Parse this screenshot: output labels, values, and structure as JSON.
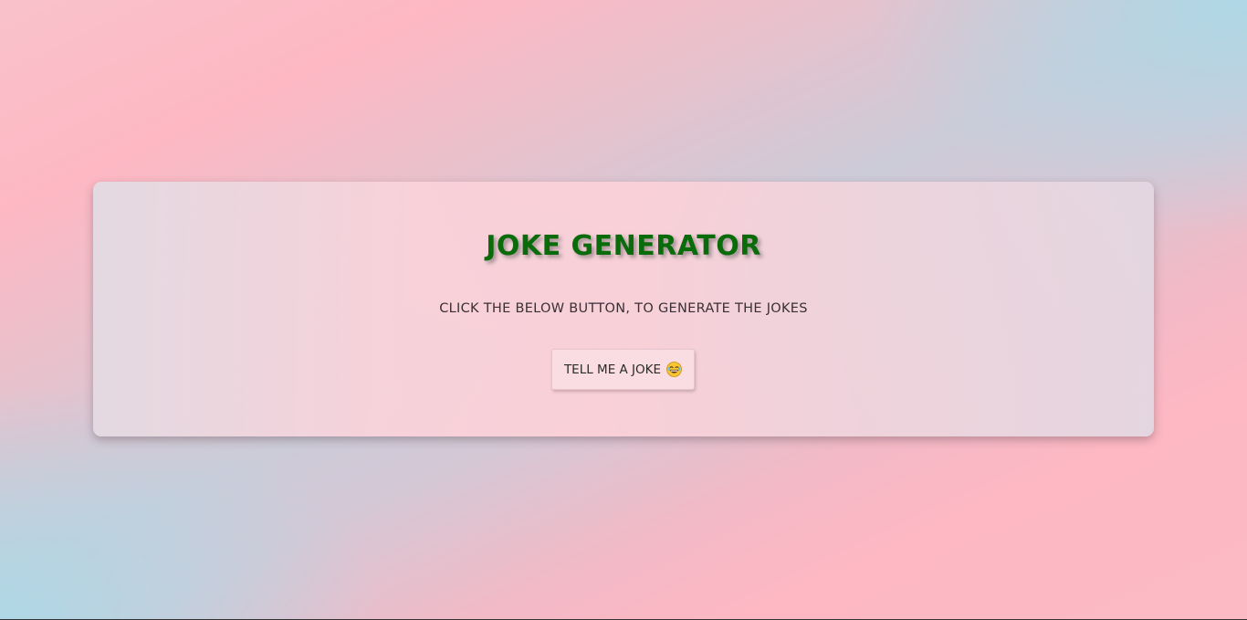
{
  "app": {
    "title": "JOKE GENERATOR",
    "subtitle": "CLICK THE BELOW BUTTON, TO GENERATE THE JOKES"
  },
  "button": {
    "label": "TELL ME A JOKE",
    "icon": "laughing-emoji-icon"
  },
  "colors": {
    "title": "#0a6b0a",
    "background_pink": "#fdb8c3",
    "background_blue": "#add8e6"
  }
}
